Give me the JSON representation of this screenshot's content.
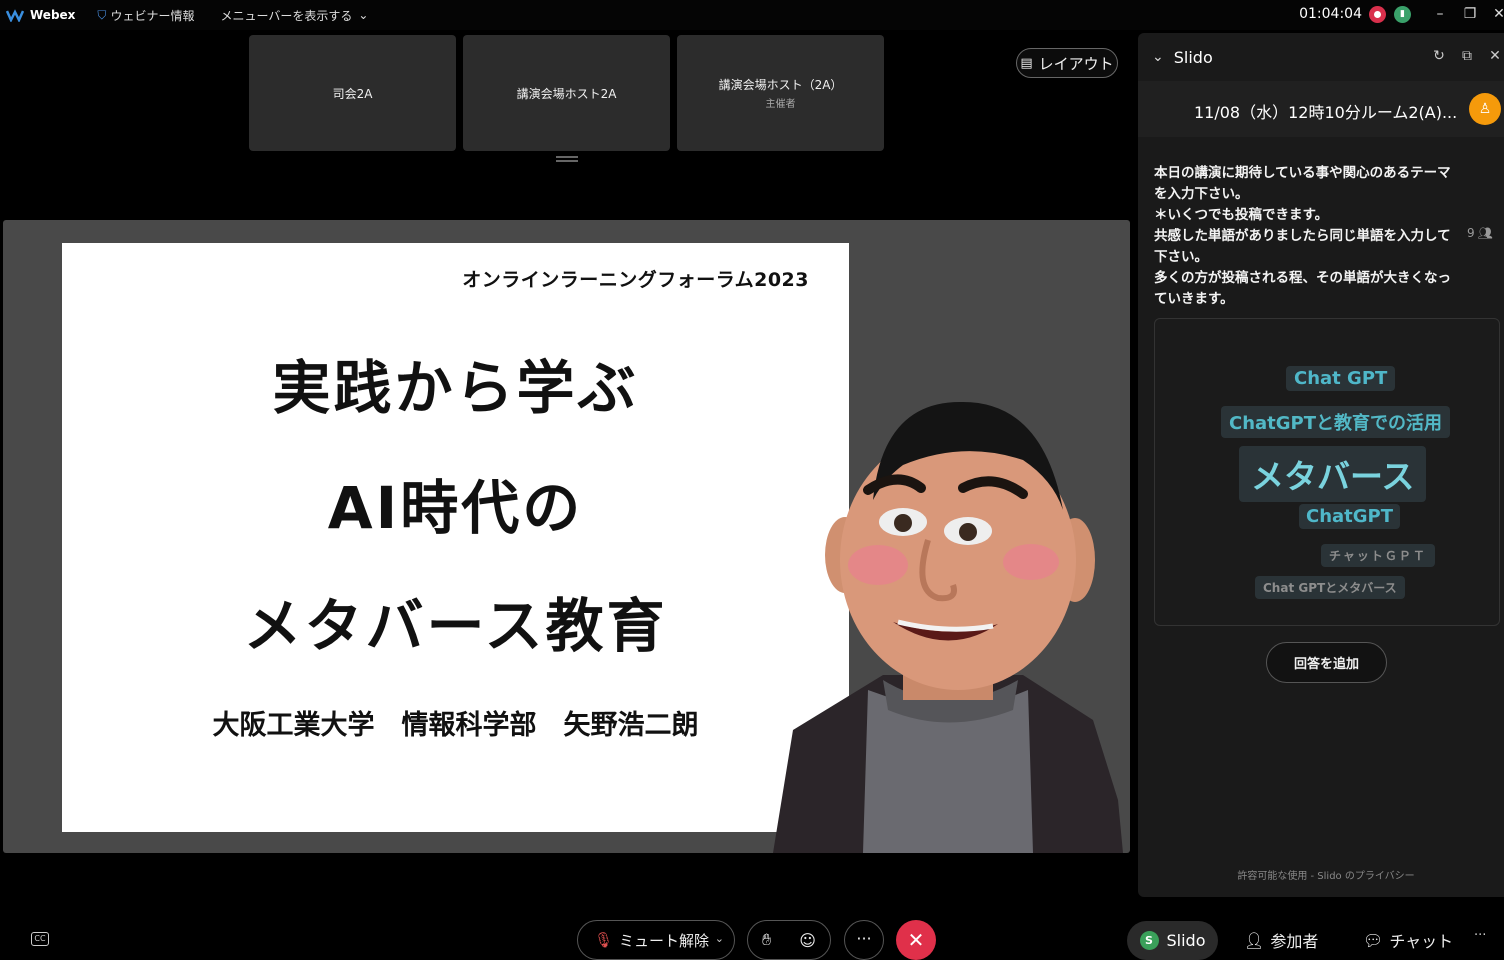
{
  "titlebar": {
    "app_name": "Webex",
    "webinar_info": "ウェビナー情報",
    "menu_toggle": "メニューバーを表示する",
    "clock": "01:04:04"
  },
  "thumbnails": [
    {
      "label": "司会2A",
      "sub": ""
    },
    {
      "label": "講演会場ホスト2A",
      "sub": ""
    },
    {
      "label": "講演会場ホスト（2A）",
      "sub": "主催者"
    }
  ],
  "layout_button": "レイアウト",
  "slide": {
    "forum": "オンラインラーニングフォーラム2023",
    "line1": "実践から学ぶ",
    "line2": "AI時代の",
    "line3": "メタバース教育",
    "author": "大阪工業大学　情報科学部　矢野浩二朗"
  },
  "slido": {
    "title": "Slido",
    "event_title": "11/08（水）12時10分ルーム2(A)...",
    "question": [
      "本日の講演に期待している事や関心のあるテーマを入力下さい。",
      "＊いくつでも投稿できます。",
      "共感した単語がありましたら同じ単語を入力して下さい。",
      "多くの方が投稿される程、その単語が大きくなっていきます。"
    ],
    "participant_count": "9",
    "word_cloud": [
      "Chat GPT",
      "ChatGPTと教育での活用",
      "メタバース",
      "ChatGPT",
      "チャットＧＰＴ",
      "Chat GPTとメタバース"
    ],
    "add_answer": "回答を追加",
    "footer": "許容可能な使用 - Slido のプライバシー"
  },
  "controls": {
    "mute": "ミュート解除",
    "slido_tab": "Slido",
    "participants_tab": "参加者",
    "chat_tab": "チャット"
  },
  "colors": {
    "leave": "#e0304a",
    "accent_word": "#4fb7c9",
    "user_avatar": "#f59a0b"
  }
}
